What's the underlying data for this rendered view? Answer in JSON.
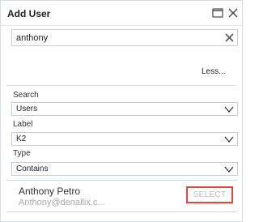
{
  "dialog": {
    "title": "Add User",
    "maximize_icon": "maximize-icon",
    "close_icon": "close-icon"
  },
  "search": {
    "value": "anthony",
    "placeholder": "",
    "clear_icon": "clear-icon"
  },
  "less_link": "Less...",
  "filters": {
    "search_label": "Search",
    "search_value": "Users",
    "label_label": "Label",
    "label_value": "K2",
    "type_label": "Type",
    "type_value": "Contains"
  },
  "results": [
    {
      "name": "Anthony Petro",
      "email": "Anthony@denallix.c...",
      "action": "SELECT"
    }
  ],
  "colors": {
    "highlight_border": "#e0473a",
    "row_border": "#c7dbe6",
    "muted_text": "#a8a8a8"
  }
}
